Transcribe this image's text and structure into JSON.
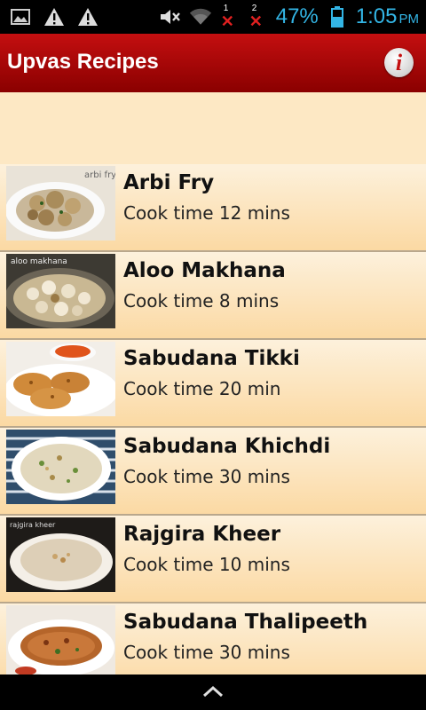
{
  "status_bar": {
    "battery_percent": "47%",
    "time": "1:05",
    "ampm": "PM",
    "sim1": "1",
    "sim2": "2"
  },
  "action_bar": {
    "title": "Upvas Recipes",
    "info_icon": "info-icon"
  },
  "recipes": [
    {
      "name": "Arbi Fry",
      "time": "Cook time 12 mins",
      "thumb_caption": "arbi fry"
    },
    {
      "name": "Aloo Makhana",
      "time": "Cook time 8 mins",
      "thumb_caption": "aloo makhana"
    },
    {
      "name": "Sabudana Tikki",
      "time": "Cook time 20 min",
      "thumb_caption": ""
    },
    {
      "name": "Sabudana Khichdi",
      "time": "Cook time 30 mins",
      "thumb_caption": ""
    },
    {
      "name": "Rajgira Kheer",
      "time": "Cook time 10 mins",
      "thumb_caption": "rajgira kheer"
    },
    {
      "name": "Sabudana Thalipeeth",
      "time": "Cook time 30 mins",
      "thumb_caption": ""
    }
  ],
  "colors": {
    "action_bar": "#b00000",
    "background": "#fde8c4",
    "status_accent": "#33b5e5"
  }
}
